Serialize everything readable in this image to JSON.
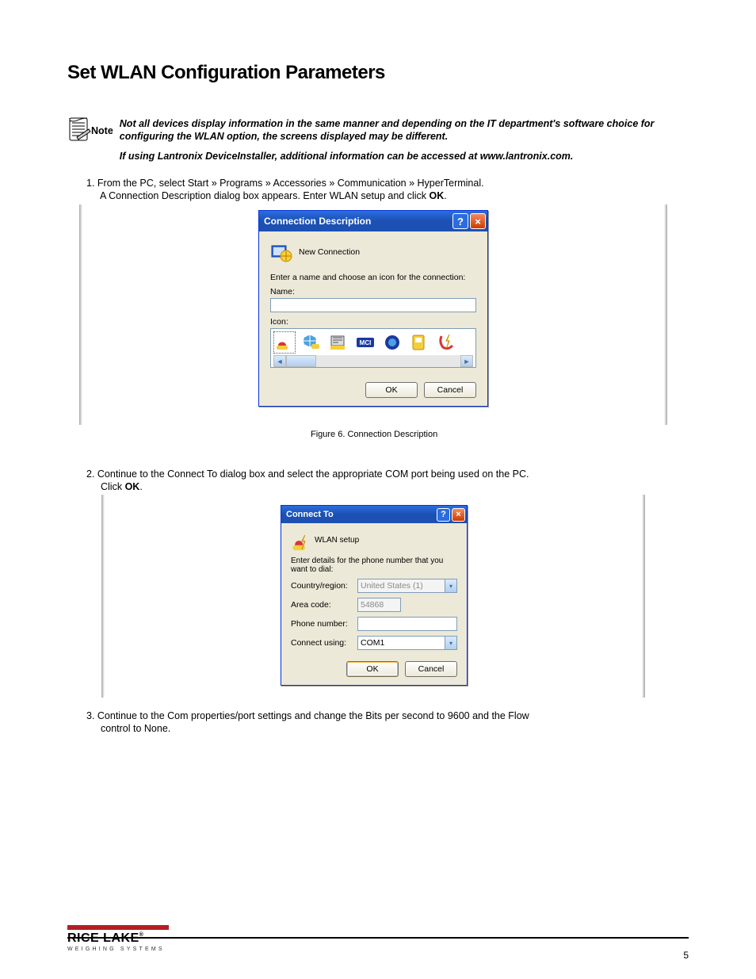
{
  "page": {
    "title": "Set WLAN Configuration Parameters",
    "number": "5"
  },
  "note": {
    "label": "Note",
    "p1": "Not all devices display information in the same manner and depending on the IT department's software choice for configuring the WLAN option, the screens displayed may be different.",
    "p2": "If using Lantronix DeviceInstaller, additional information can be accessed at  www.lantronix.com."
  },
  "step1": {
    "line1": "1.   From the PC, select Start » Programs » Accessories » Communication » HyperTerminal.",
    "line2": "A Connection Description dialog box appears. Enter WLAN setup and click ",
    "ok": "OK",
    "line2b": ".",
    "fig": "Figure 6. Connection Description"
  },
  "step2": {
    "line1": "2.   Continue to the Connect To dialog box and select the appropriate COM port being used on the PC.",
    "line2_a": "Click ",
    "ok": "OK",
    "line2_b": "."
  },
  "step3": {
    "line1": "3.   Continue to the Com properties/port settings and change the Bits per second to 9600 and the Flow",
    "line2": "control to None."
  },
  "dialog1": {
    "title": "Connection Description",
    "icon_row": "New Connection",
    "hint": "Enter a name and choose an icon for the connection:",
    "name_label": "Name:",
    "name_value": "",
    "icon_label": "Icon:",
    "icons": [
      "phone-modem-icon",
      "globe-phone-icon",
      "modem-icon",
      "mci-icon",
      "globe-dark-icon",
      "satellite-icon",
      "phone-lightning-icon"
    ],
    "ok": "OK",
    "cancel": "Cancel"
  },
  "dialog2": {
    "title": "Connect To",
    "icon_row": "WLAN setup",
    "hint": "Enter details for the phone number that you want to dial:",
    "country_label": "Country/region:",
    "country_value": "United States (1)",
    "area_label": "Area code:",
    "area_value": "54868",
    "phone_label": "Phone number:",
    "phone_value": "",
    "connect_label": "Connect using:",
    "connect_value": "COM1",
    "ok": "OK",
    "cancel": "Cancel"
  },
  "footer": {
    "brand1": "RICE LAKE",
    "brand2": "WEIGHING SYSTEMS"
  }
}
